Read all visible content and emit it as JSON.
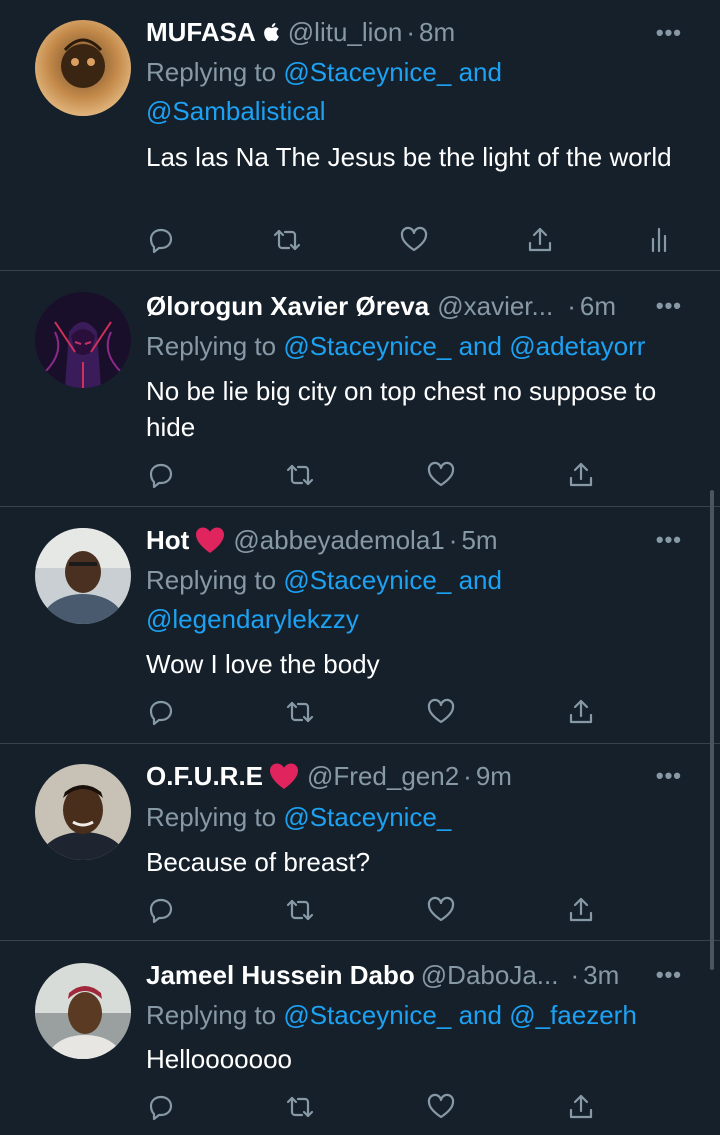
{
  "colors": {
    "background": "#15202b",
    "mention": "#1da1f2",
    "secondary_text": "#8899a6",
    "divider": "#38444d",
    "heart": "#e0245e"
  },
  "tweets": [
    {
      "name": "MUFASA",
      "name_emoji": "apple-icon",
      "handle": "@litu_lion",
      "time": "8m",
      "replying_prefix": "Replying to",
      "replying_mentions_1": "@Staceynice_",
      "replying_and": "and",
      "replying_mentions_2": "@Sambalistical",
      "text": "Las las Na The Jesus be the light of the world",
      "more": "•••"
    },
    {
      "name": "Ølorogun Xavier Øreva",
      "handle": "@xavier...",
      "time": "6m",
      "replying_prefix": "Replying to",
      "replying_mentions_1": "@Staceynice_",
      "replying_and": "and",
      "replying_mentions_2": "@adetayorr",
      "text": "No be lie big city on top chest no suppose to hide",
      "more": "•••"
    },
    {
      "name": "Hot",
      "name_emoji": "heart-emoji",
      "handle": "@abbeyademola1",
      "time": "5m",
      "replying_prefix": "Replying to",
      "replying_mentions_1": "@Staceynice_",
      "replying_and": "and",
      "replying_mentions_2": "@legendarylekzzy",
      "text": "Wow I love the body",
      "more": "•••"
    },
    {
      "name": "O.F.U.R.E",
      "name_emoji": "heart-emoji",
      "handle": "@Fred_gen2",
      "time": "9m",
      "replying_prefix": "Replying to",
      "replying_mentions_1": "@Staceynice_",
      "text": "Because of breast?",
      "more": "•••"
    },
    {
      "name": "Jameel Hussein Dabo",
      "handle": "@DaboJa...",
      "time": "3m",
      "replying_prefix": "Replying to",
      "replying_mentions_1": "@Staceynice_",
      "replying_and": "and",
      "replying_mentions_2": "@_faezerh",
      "text": "Hellooooooo",
      "more": "•••"
    }
  ],
  "action_icons": [
    "reply-icon",
    "retweet-icon",
    "like-icon",
    "share-icon",
    "analytics-icon"
  ],
  "separator": "·"
}
